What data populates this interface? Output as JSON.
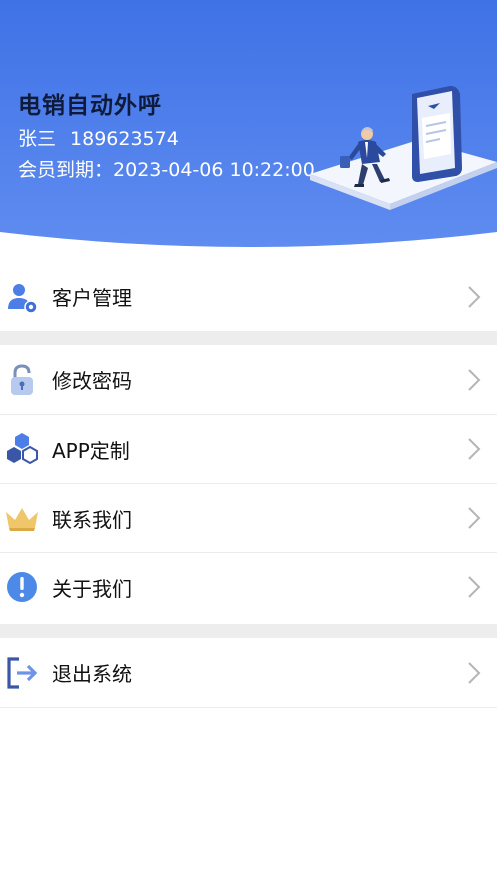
{
  "header": {
    "app_title": "电销自动外呼",
    "user_name": "张三",
    "user_phone": "189623574",
    "expiry_label": "会员到期：",
    "expiry_value": "2023-04-06 10:22:00",
    "gradient_top": "#3f72e6",
    "gradient_bottom": "#5a88ef"
  },
  "menu": {
    "customer_management": "客户管理",
    "change_password": "修改密码",
    "app_customize": "APP定制",
    "contact_us": "联系我们",
    "about_us": "关于我们",
    "logout": "退出系统"
  },
  "icons": {
    "customer": "user-gear-icon",
    "password": "padlock-icon",
    "app": "hexagons-icon",
    "contact": "crown-icon",
    "about": "info-icon",
    "logout": "exit-icon",
    "chevron": "chevron-right-icon"
  },
  "colors": {
    "accent": "#3f72e6",
    "icon_blue": "#4d7de6",
    "crown_gold": "#f0c66a",
    "separator": "#ededed"
  }
}
